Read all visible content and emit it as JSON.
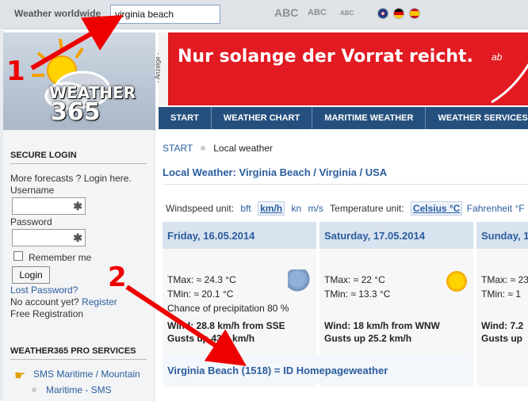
{
  "topbar": {
    "title": "Weather worldwide",
    "search_value": "virginia beach",
    "font_sizes": [
      "ABC",
      "ABC",
      "ABC"
    ]
  },
  "header": {
    "logo_line1": "WEATHER",
    "logo_line2": "365",
    "ad_label": "- Anzeige -",
    "ad_slogan": "Nur solange der Vorrat reicht.",
    "ad_tag": "ab",
    "nav": [
      "START",
      "WEATHER CHART",
      "MARITIME WEATHER",
      "WEATHER SERVICES"
    ]
  },
  "sidebar": {
    "secure_login": "SECURE LOGIN",
    "more_forecasts": "More forecasts ? Login here.",
    "username_label": "Username",
    "password_label": "Password",
    "remember": "Remember me",
    "login_btn": "Login",
    "lost_password": "Lost Password?",
    "no_account": "No account yet?",
    "register": "Register",
    "free_reg": "Free Registration",
    "pro_services": "WEATHER365 PRO SERVICES",
    "sms_maritime": "SMS  Maritime / Mountain",
    "maritime_sms": "Maritime - SMS"
  },
  "main": {
    "breadcrumb_start": "START",
    "breadcrumb_current": "Local weather",
    "title": "Local Weather: Virginia Beach / Virginia / USA",
    "units": {
      "wind_label": "Windspeed unit:",
      "wind_options": [
        "bft",
        "km/h",
        "kn",
        "m/s"
      ],
      "wind_selected": "km/h",
      "temp_label": "Temperature unit:",
      "temp_selected": "Celsius °C",
      "temp_other": "Fahrenheit °F"
    },
    "days": [
      {
        "date": "Friday, 16.05.2014",
        "tmax": "TMax: ≈ 24.3 °C",
        "tmin": "TMin: ≈ 20.1 °C",
        "precip": "Chance of precipitation 80 %",
        "wind": "Wind: 28.8 km/h from SSE",
        "gusts": "Gusts up 43.2 km/h",
        "icon": "rain-cloud-icon"
      },
      {
        "date": "Saturday, 17.05.2014",
        "tmax": "TMax: ≈ 22 °C",
        "tmin": "TMin: ≈ 13.3 °C",
        "wind": "Wind: 18 km/h from WNW",
        "gusts": "Gusts up 25.2 km/h",
        "icon": "sun-icon"
      },
      {
        "date": "Sunday, 1",
        "tmax": "TMax: ≈ 23",
        "tmin": "TMin: ≈ 1",
        "wind": "Wind: 7.2",
        "gusts": "Gusts up"
      }
    ],
    "homepage_weather": "Virginia Beach (1518) = ID Homepageweather"
  },
  "annotations": {
    "one": "1",
    "two": "2"
  }
}
